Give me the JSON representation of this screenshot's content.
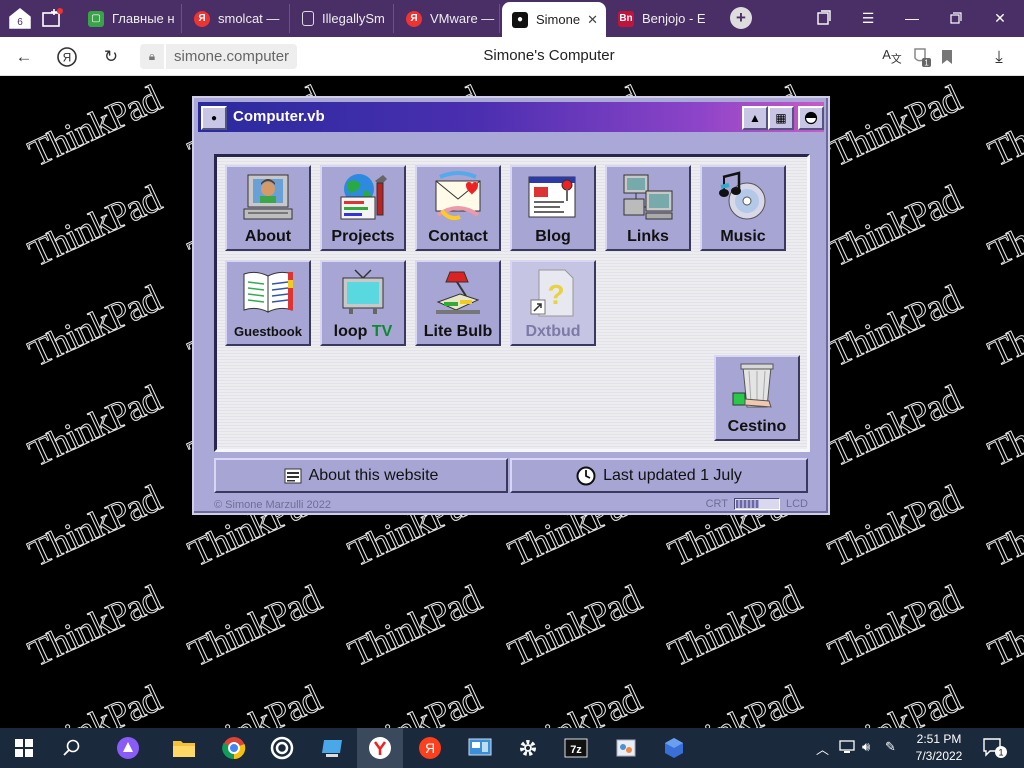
{
  "browser": {
    "tabs": [
      {
        "label": "Главные н",
        "icon": "page-icon",
        "color": "#3aa34a"
      },
      {
        "label": "smolcat —",
        "icon": "yandex-icon",
        "color": "#e33"
      },
      {
        "label": "IllegallySm",
        "icon": "document-icon",
        "color": "#888"
      },
      {
        "label": "VMware —",
        "icon": "yandex-icon",
        "color": "#e33"
      },
      {
        "label": "Simone",
        "icon": "site-icon",
        "color": "#000"
      },
      {
        "label": "Benjojo - E",
        "icon": "bn-icon",
        "color": "#c0143c"
      }
    ],
    "tab_count": "6",
    "active_tab_index": 4,
    "url": "simone.computer",
    "page_title": "Simone's Computer",
    "extension_badge": "1"
  },
  "watermark_text": "ThinkPad",
  "window": {
    "title": "Computer.vb",
    "icons": [
      {
        "label": "About",
        "icon": "computer-person-icon"
      },
      {
        "label": "Projects",
        "icon": "globe-tools-icon"
      },
      {
        "label": "Contact",
        "icon": "mail-letter-icon"
      },
      {
        "label": "Blog",
        "icon": "blog-page-icon"
      },
      {
        "label": "Links",
        "icon": "network-computers-icon"
      },
      {
        "label": "Music",
        "icon": "music-cd-icon"
      },
      {
        "label": "Guestbook",
        "icon": "open-book-icon"
      },
      {
        "label": "loop",
        "label_suffix": "TV",
        "icon": "television-icon"
      },
      {
        "label": "Lite Bulb",
        "icon": "desk-lamp-icon"
      },
      {
        "label": "Dxtbud",
        "icon": "unknown-file-icon",
        "disabled": true
      }
    ],
    "trash": {
      "label": "Cestino",
      "icon": "recycle-bin-icon"
    },
    "footer_buttons": [
      {
        "label": "About this website",
        "icon": "document-list-icon"
      },
      {
        "label": "Last updated 1 July",
        "icon": "clock-icon"
      }
    ],
    "copyright": "© Simone Marzulli 2022",
    "display_toggle": {
      "left": "CRT",
      "right": "LCD",
      "level": 0.55
    }
  },
  "taskbar": {
    "time": "2:51 PM",
    "date": "7/3/2022",
    "notification_count": "1"
  }
}
